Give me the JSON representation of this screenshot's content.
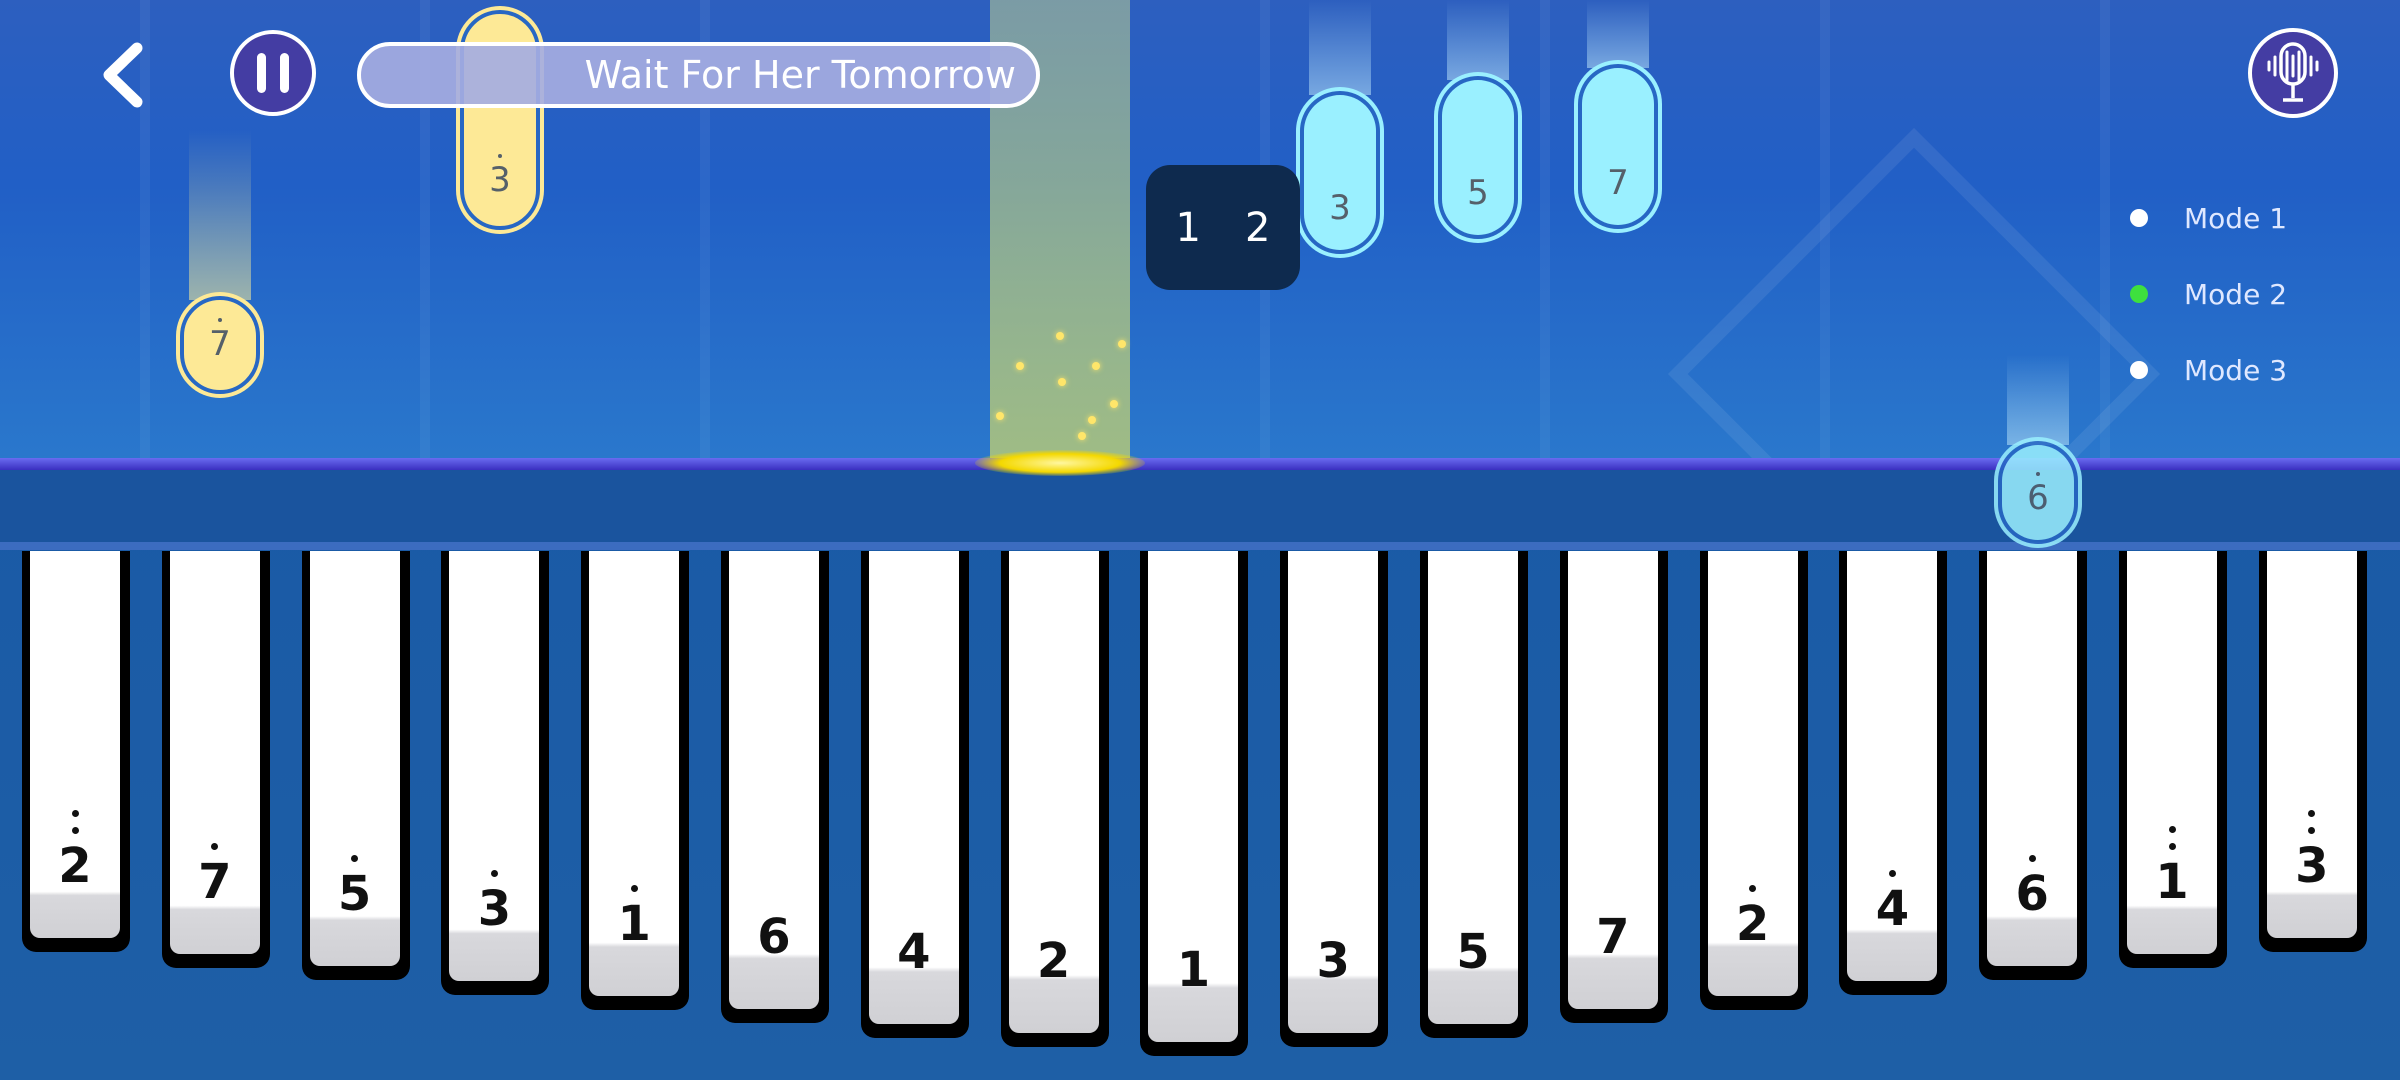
{
  "header": {
    "back_icon": "chevron-left-icon",
    "pause_icon": "pause-icon",
    "song_title": "Wait For Her Tomorrow",
    "mic_icon": "microphone-waveform-icon"
  },
  "combo": {
    "left": "1",
    "right": "2"
  },
  "modes": [
    {
      "label": "Mode 1",
      "color": "#ffffff",
      "active": false
    },
    {
      "label": "Mode 2",
      "color": "#3ee03e",
      "active": true
    },
    {
      "label": "Mode 3",
      "color": "#ffffff",
      "active": false
    }
  ],
  "falling_notes": [
    {
      "label": "7",
      "dots": 1,
      "color": "yellow"
    },
    {
      "label": "3",
      "dots": 1,
      "color": "yellow"
    },
    {
      "label": "3",
      "dots": 0,
      "color": "cyan"
    },
    {
      "label": "5",
      "dots": 0,
      "color": "cyan"
    },
    {
      "label": "7",
      "dots": 0,
      "color": "cyan"
    },
    {
      "label": "6",
      "dots": 1,
      "color": "cyan"
    }
  ],
  "keys": [
    {
      "label": "2",
      "dots": 2
    },
    {
      "label": "7",
      "dots": 1
    },
    {
      "label": "5",
      "dots": 1
    },
    {
      "label": "3",
      "dots": 1
    },
    {
      "label": "1",
      "dots": 1
    },
    {
      "label": "6",
      "dots": 0
    },
    {
      "label": "4",
      "dots": 0
    },
    {
      "label": "2",
      "dots": 0
    },
    {
      "label": "1",
      "dots": 0
    },
    {
      "label": "3",
      "dots": 0
    },
    {
      "label": "5",
      "dots": 0
    },
    {
      "label": "7",
      "dots": 0
    },
    {
      "label": "2",
      "dots": 1
    },
    {
      "label": "4",
      "dots": 1
    },
    {
      "label": "6",
      "dots": 1
    },
    {
      "label": "1",
      "dots": 2
    },
    {
      "label": "3",
      "dots": 2
    }
  ],
  "colors": {
    "note_yellow": "#fde996",
    "note_cyan": "#9af0ff",
    "hit_line": "#4a44d8",
    "active_mode": "#3ee03e"
  }
}
